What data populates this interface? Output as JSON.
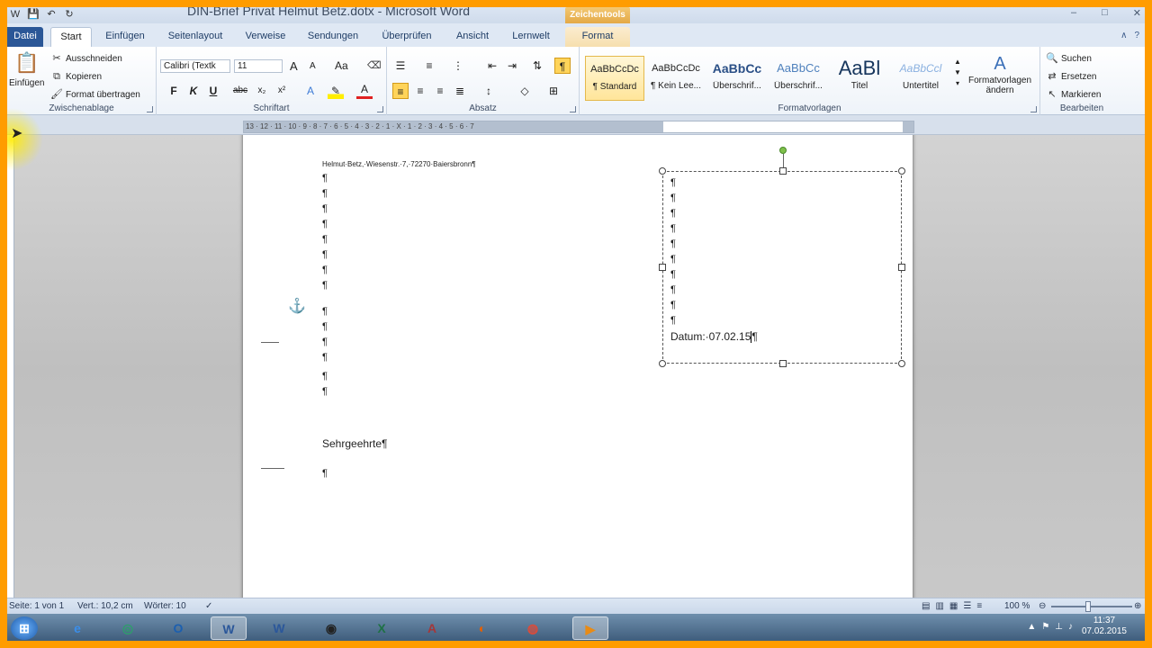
{
  "window": {
    "title": "DIN-Brief Privat Helmut Betz.dotx - Microsoft Word",
    "context_tab": "Zeichentools",
    "controls": [
      "–",
      "□",
      "✕"
    ]
  },
  "tabs": [
    {
      "label": "Datei"
    },
    {
      "label": "Start"
    },
    {
      "label": "Einfügen"
    },
    {
      "label": "Seitenlayout"
    },
    {
      "label": "Verweise"
    },
    {
      "label": "Sendungen"
    },
    {
      "label": "Überprüfen"
    },
    {
      "label": "Ansicht"
    },
    {
      "label": "Lernwelt"
    },
    {
      "label": "Format"
    }
  ],
  "ribbon": {
    "clipboard": {
      "paste": "Einfügen",
      "cut": "Ausschneiden",
      "copy": "Kopieren",
      "format_painter": "Format übertragen",
      "label": "Zwischenablage"
    },
    "font": {
      "family": "Calibri (Textk",
      "size": "11",
      "label": "Schriftart",
      "bold": "F",
      "italic": "K",
      "underline": "U",
      "strike": "abc",
      "subscript": "x₂",
      "superscript": "x²",
      "grow": "A",
      "shrink": "A",
      "case": "Aa",
      "color": "A"
    },
    "paragraph": {
      "label": "Absatz",
      "pilcrow": "¶"
    },
    "styles": {
      "label": "Formatvorlagen",
      "items": [
        {
          "sample": "AaBbCcDc",
          "name": "¶ Standard"
        },
        {
          "sample": "AaBbCcDc",
          "name": "¶ Kein Lee..."
        },
        {
          "sample": "AaBbCc",
          "name": "Überschrif..."
        },
        {
          "sample": "AaBbCc",
          "name": "Überschrif..."
        },
        {
          "sample": "AaBl",
          "name": "Titel"
        },
        {
          "sample": "AaBbCcl",
          "name": "Untertitel"
        }
      ],
      "change": "Formatvorlagen",
      "change2": "ändern"
    },
    "editing": {
      "label": "Bearbeiten",
      "find": "Suchen",
      "replace": "Ersetzen",
      "select": "Markieren"
    }
  },
  "ruler": {
    "numbers": "13 · 12 · 11 · 10 · 9 · 8 · 7 · 6 · 5 · 4 · 3 · 2 · 1 · X · 1 · 2 · 3 · 4 · 5 · 6 · 7"
  },
  "document": {
    "sender": "Helmut·Betz,·Wiesenstr.·7,·72270·Baiersbronn¶",
    "pilcrow": "¶",
    "date_label": "Datum:·07.02.15",
    "greeting": "Sehrgeehrte¶"
  },
  "statusbar": {
    "page": "Seite: 1 von 1",
    "position": "Vert.: 10,2 cm",
    "words": "Wörter: 10",
    "zoom": "100 %"
  },
  "taskbar": {
    "time": "11:37",
    "date": "07.02.2015"
  }
}
